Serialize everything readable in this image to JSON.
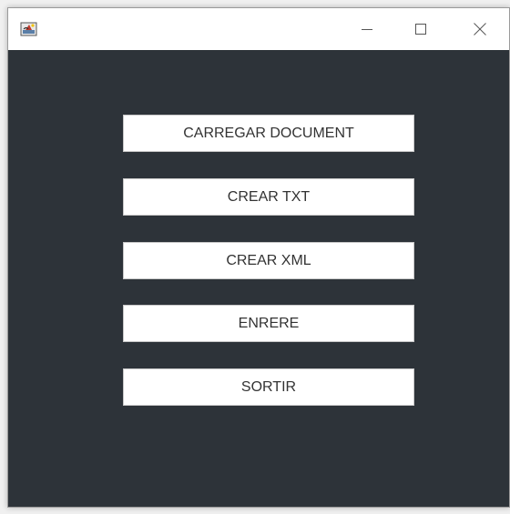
{
  "window": {
    "icon": "java-app-icon",
    "controls": {
      "minimize_icon": "minimize-icon",
      "maximize_icon": "maximize-icon",
      "close_icon": "close-icon"
    }
  },
  "colors": {
    "content_background": "#2d3339",
    "titlebar_background": "#ffffff",
    "button_background": "#ffffff",
    "button_text": "#333333"
  },
  "menu": {
    "buttons": [
      {
        "label": "CARREGAR DOCUMENT"
      },
      {
        "label": "CREAR TXT"
      },
      {
        "label": "CREAR XML"
      },
      {
        "label": "ENRERE"
      },
      {
        "label": "SORTIR"
      }
    ]
  }
}
